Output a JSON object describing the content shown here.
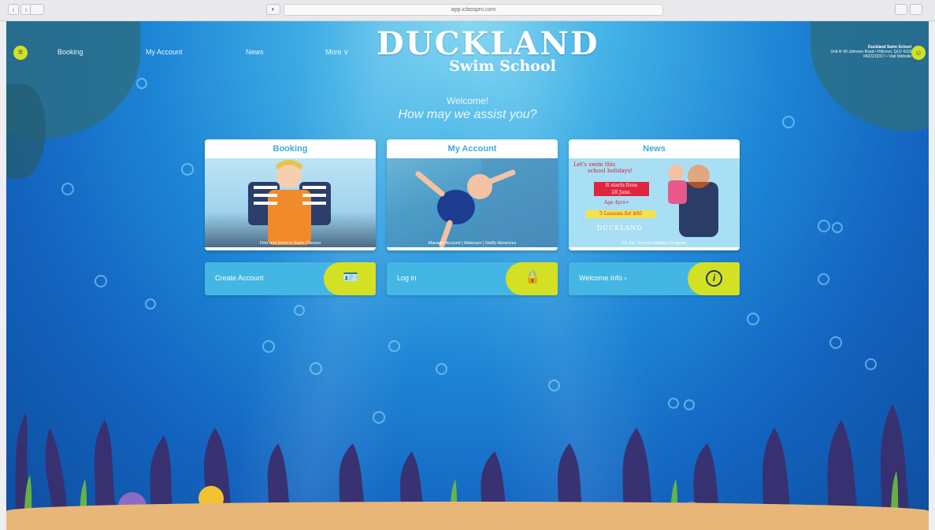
{
  "browser": {
    "url": "app.iclasspro.com"
  },
  "nav": {
    "booking": "Booking",
    "my_account": "My Account",
    "news": "News",
    "more": "More ∨"
  },
  "logo": {
    "line1": "DUCKLAND",
    "line2": "Swim School"
  },
  "school": {
    "name": "Duckland Swim School",
    "address": "Unit 4/ 40 Johnson Road • Hillcrest, QLD 4118",
    "contact": "0422215317 • Visit Website"
  },
  "welcome": {
    "line1": "Welcome!",
    "line2": "How may we assist you?"
  },
  "cards": [
    {
      "title": "Booking",
      "caption": "Find and Enrol in Swim Classes"
    },
    {
      "title": "My Account",
      "caption": "Manage Account | Makeups | Notify Absences"
    },
    {
      "title": "News",
      "caption": "22 Jun: School Holidays Program",
      "poster": {
        "headline1": "Let's swim this",
        "headline2": "school holidays!",
        "starts1": "It starts from",
        "starts2": "28 June.",
        "age": "Age 4yrs+",
        "lessons": "5 Lessons for $60",
        "brand": "DUCKLAND"
      }
    }
  ],
  "actions": [
    {
      "label": "Create Account",
      "icon": "id-card-icon"
    },
    {
      "label": "Log in",
      "icon": "lock-icon"
    },
    {
      "label": "Welcome Info ›",
      "icon": "info-icon"
    }
  ],
  "colors": {
    "accent": "#d4e023",
    "card_title": "#3fa8dd",
    "action_bg": "#44b6e4"
  }
}
